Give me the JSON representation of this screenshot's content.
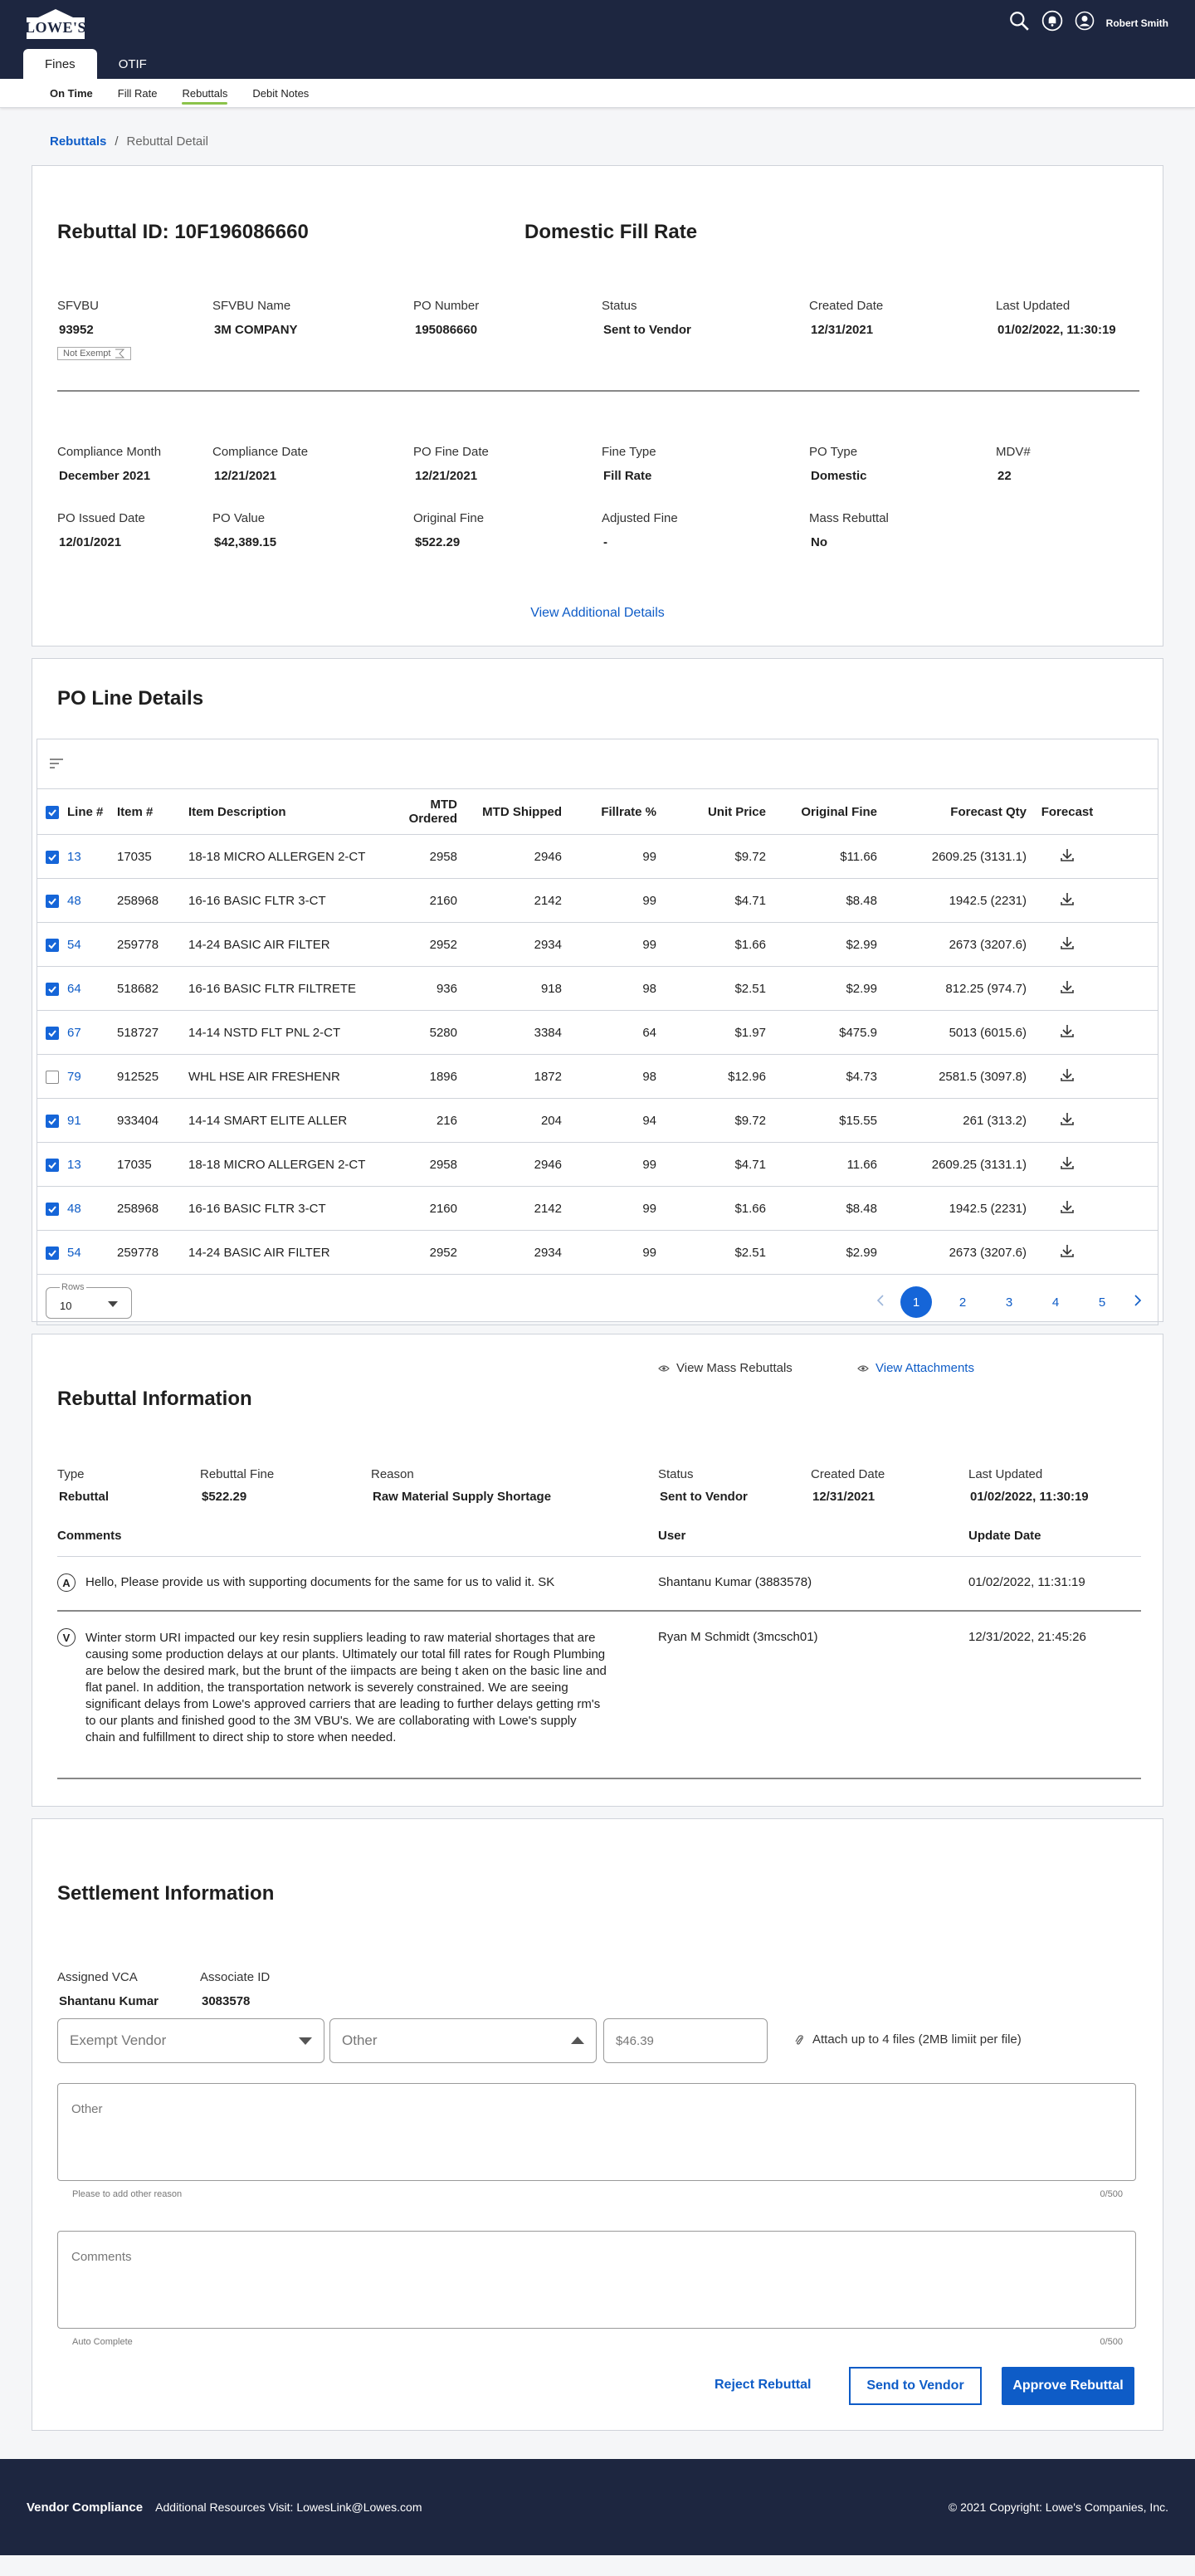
{
  "header": {
    "logo": "LOWE'S",
    "user": "Robert Smith"
  },
  "tabs": [
    "Fines",
    "OTIF"
  ],
  "subnav": [
    "On Time",
    "Fill Rate",
    "Rebuttals",
    "Debit Notes"
  ],
  "breadcrumb": {
    "link": "Rebuttals",
    "sep": "/",
    "current": "Rebuttal Detail"
  },
  "rebuttal": {
    "title": "Rebuttal ID:  10F196086660",
    "type": "Domestic Fill Rate",
    "badge": "Not Exempt",
    "row1": [
      {
        "label": "SFVBU",
        "value": "93952"
      },
      {
        "label": "SFVBU Name",
        "value": "3M COMPANY"
      },
      {
        "label": "PO Number",
        "value": "195086660"
      },
      {
        "label": "Status",
        "value": "Sent to Vendor"
      },
      {
        "label": "Created Date",
        "value": "12/31/2021"
      },
      {
        "label": "Last Updated",
        "value": "01/02/2022, 11:30:19"
      }
    ],
    "row2": [
      {
        "label": "Compliance Month",
        "value": "December 2021"
      },
      {
        "label": "Compliance Date",
        "value": "12/21/2021"
      },
      {
        "label": "PO Fine Date",
        "value": "12/21/2021"
      },
      {
        "label": "Fine Type",
        "value": "Fill Rate"
      },
      {
        "label": "PO Type",
        "value": "Domestic"
      },
      {
        "label": "MDV#",
        "value": "22"
      }
    ],
    "row3": [
      {
        "label": "PO Issued Date",
        "value": "12/01/2021"
      },
      {
        "label": "PO Value",
        "value": "$42,389.15"
      },
      {
        "label": "Original Fine",
        "value": "$522.29"
      },
      {
        "label": "Adjusted Fine",
        "value": "-"
      },
      {
        "label": "Mass Rebuttal",
        "value": "No"
      }
    ],
    "view_more": "View Additional Details"
  },
  "po_lines": {
    "title": "PO Line Details",
    "headers": [
      "Line #",
      "Item #",
      "Item Description",
      "MTD Ordered",
      "MTD Shipped",
      "Fillrate %",
      "Unit Price",
      "Original Fine",
      "Forecast Qty",
      "Forecast"
    ],
    "rows": [
      {
        "checked": true,
        "line": "13",
        "item": "17035",
        "desc": "18-18 MICRO ALLERGEN 2-CT",
        "mtdo": "2958",
        "mtds": "2946",
        "fill": "99",
        "price": "$9.72",
        "fine": "$11.66",
        "fq": "2609.25 (3131.1)"
      },
      {
        "checked": true,
        "line": "48",
        "item": "258968",
        "desc": "16-16 BASIC FLTR 3-CT",
        "mtdo": "2160",
        "mtds": "2142",
        "fill": "99",
        "price": "$4.71",
        "fine": "$8.48",
        "fq": "1942.5 (2231)"
      },
      {
        "checked": true,
        "line": "54",
        "item": "259778",
        "desc": "14-24 BASIC AIR FILTER",
        "mtdo": "2952",
        "mtds": "2934",
        "fill": "99",
        "price": "$1.66",
        "fine": "$2.99",
        "fq": "2673 (3207.6)"
      },
      {
        "checked": true,
        "line": "64",
        "item": "518682",
        "desc": "16-16 BASIC FLTR FILTRETE",
        "mtdo": "936",
        "mtds": "918",
        "fill": "98",
        "price": "$2.51",
        "fine": "$2.99",
        "fq": "812.25 (974.7)"
      },
      {
        "checked": true,
        "line": "67",
        "item": "518727",
        "desc": "14-14 NSTD FLT PNL 2-CT",
        "mtdo": "5280",
        "mtds": "3384",
        "fill": "64",
        "price": "$1.97",
        "fine": "$475.9",
        "fq": "5013 (6015.6)"
      },
      {
        "checked": false,
        "line": "79",
        "item": "912525",
        "desc": "WHL HSE AIR FRESHENR",
        "mtdo": "1896",
        "mtds": "1872",
        "fill": "98",
        "price": "$12.96",
        "fine": "$4.73",
        "fq": "2581.5 (3097.8)"
      },
      {
        "checked": true,
        "line": "91",
        "item": "933404",
        "desc": "14-14 SMART ELITE ALLER",
        "mtdo": "216",
        "mtds": "204",
        "fill": "94",
        "price": "$9.72",
        "fine": "$15.55",
        "fq": "261 (313.2)"
      },
      {
        "checked": true,
        "line": "13",
        "item": "17035",
        "desc": "18-18 MICRO ALLERGEN 2-CT",
        "mtdo": "2958",
        "mtds": "2946",
        "fill": "99",
        "price": "$4.71",
        "fine": "11.66",
        "fq": "2609.25 (3131.1)"
      },
      {
        "checked": true,
        "line": "48",
        "item": "258968",
        "desc": "16-16 BASIC FLTR 3-CT",
        "mtdo": "2160",
        "mtds": "2142",
        "fill": "99",
        "price": "$1.66",
        "fine": "$8.48",
        "fq": "1942.5 (2231)"
      },
      {
        "checked": true,
        "line": "54",
        "item": "259778",
        "desc": "14-24 BASIC AIR FILTER",
        "mtdo": "2952",
        "mtds": "2934",
        "fill": "99",
        "price": "$2.51",
        "fine": "$2.99",
        "fq": "2673 (3207.6)"
      }
    ],
    "rows_label": "Rows",
    "rows_value": "10",
    "pages": [
      "1",
      "2",
      "3",
      "4",
      "5"
    ]
  },
  "rebuttal_info": {
    "title": "Rebuttal Information",
    "view_mass": "View Mass Rebuttals",
    "view_attach": "View Attachments",
    "fields": [
      {
        "label": "Type",
        "value": "Rebuttal"
      },
      {
        "label": "Rebuttal Fine",
        "value": "$522.29"
      },
      {
        "label": "Reason",
        "value": "Raw Material Supply Shortage"
      },
      {
        "label": "Status",
        "value": "Sent to Vendor"
      },
      {
        "label": "Created Date",
        "value": "12/31/2021"
      },
      {
        "label": "Last Updated",
        "value": "01/02/2022, 11:30:19"
      }
    ],
    "comment_headers": [
      "Comments",
      "User",
      "Update Date"
    ],
    "comments": [
      {
        "avatar": "A",
        "text": "Hello, Please provide us with supporting documents for the same for us to valid it.  SK",
        "user": "Shantanu Kumar (3883578)",
        "date": "01/02/2022, 11:31:19"
      },
      {
        "avatar": "V",
        "text": "Winter storm URI impacted our key resin suppliers leading to raw material shortages that are causing some production delays at our plants.  Ultimately our total fill rates for Rough Plumbing are below the desired mark, but the brunt of the iimpacts are being t aken on the basic line and flat panel.  In addition, the transportation network is severely constrained.  We are seeing significant delays from Lowe's approved carriers that are leading to further delays getting rm's to our plants and finished good to the 3M VBU's.  We are collaborating with Lowe's supply chain and fulfillment to direct ship to store when needed.",
        "user": "Ryan M Schmidt (3mcsch01)",
        "date": "12/31/2022, 21:45:26"
      }
    ]
  },
  "settlement": {
    "title": "Settlement Information",
    "fields": [
      {
        "label": "Assigned VCA",
        "value": "Shantanu Kumar"
      },
      {
        "label": "Associate ID",
        "value": "3083578"
      }
    ],
    "exempt": "Exempt Vendor",
    "reason": "Other",
    "amount": "$46.39",
    "attach": "Attach up to 4 files (2MB limiit per file)",
    "other_placeholder": "Other",
    "other_hint": "Please to add other reason",
    "other_count": "0/500",
    "comments_placeholder": "Comments",
    "comments_hint": "Auto Complete",
    "comments_count": "0/500",
    "reject": "Reject Rebuttal",
    "send": "Send to Vendor",
    "approve": "Approve Rebuttal"
  },
  "footer": {
    "brand": "Vendor Compliance",
    "resources": "Additional Resources Visit: LowesLink@Lowes.com",
    "copyright": "© 2021 Copyright: Lowe's Companies, Inc."
  }
}
